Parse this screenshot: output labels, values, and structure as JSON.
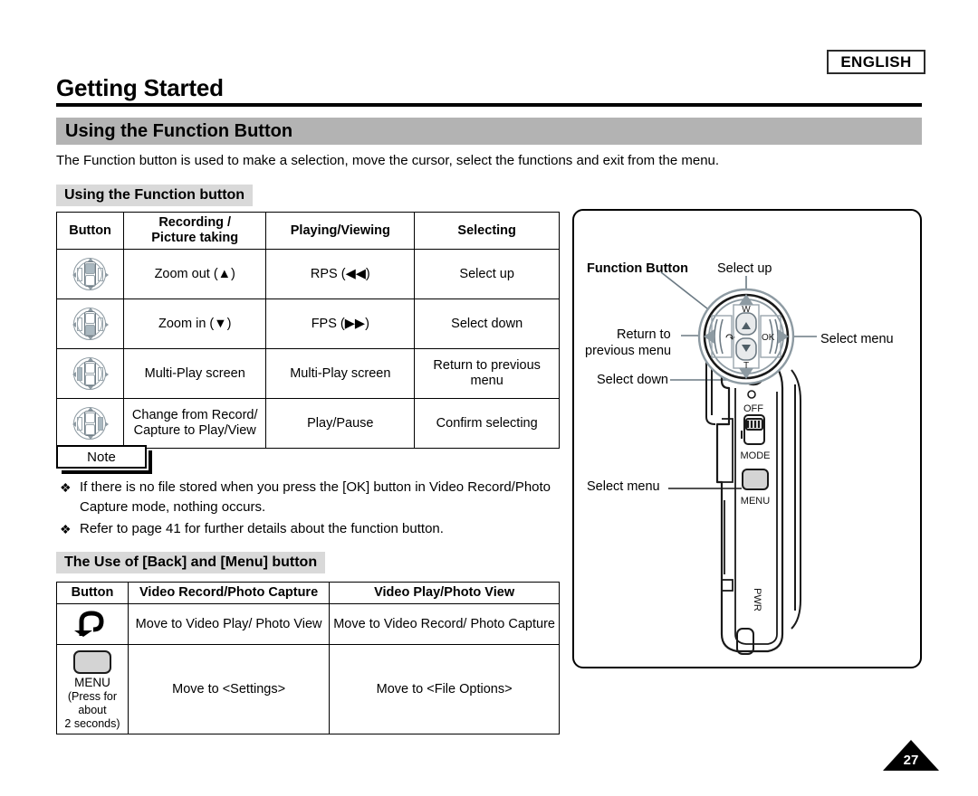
{
  "header": {
    "language_badge": "ENGLISH",
    "chapter_title": "Getting Started",
    "section_title": "Using the Function Button",
    "intro": "The Function button is used to make a selection, move the cursor, select the functions and exit from the menu."
  },
  "subheads": {
    "function_button": "Using the Function button",
    "back_menu": "The Use of [Back] and [Menu] button"
  },
  "function_table": {
    "headers": {
      "button": "Button",
      "recording": "Recording /",
      "recording2": "Picture taking",
      "playing": "Playing/Viewing",
      "selecting": "Selecting"
    },
    "rows": [
      {
        "icon": "dpad-up-icon",
        "recording": "Zoom out (▲)",
        "playing": "RPS (◀◀)",
        "selecting": "Select up"
      },
      {
        "icon": "dpad-down-icon",
        "recording": "Zoom in (▼)",
        "playing": "FPS (▶▶)",
        "selecting": "Select down"
      },
      {
        "icon": "dpad-left-icon",
        "recording": "Multi-Play screen",
        "playing": "Multi-Play screen",
        "selecting": "Return to previous menu"
      },
      {
        "icon": "dpad-right-icon",
        "recording": "Change from Record/ Capture to Play/View",
        "playing": "Play/Pause",
        "selecting": "Confirm selecting"
      }
    ]
  },
  "note": {
    "label": "Note",
    "items": [
      "If there is no file stored when you press the [OK] button in Video Record/Photo Capture mode, nothing occurs.",
      "Refer to page 41 for further details about the function button."
    ],
    "bullet": "❖"
  },
  "backmenu_table": {
    "headers": {
      "button": "Button",
      "record": "Video Record/Photo Capture",
      "play": "Video Play/Photo View"
    },
    "rows": [
      {
        "icon": "back-arrow-icon",
        "record": "Move to Video Play/ Photo View",
        "play": "Move to Video Record/ Photo Capture"
      },
      {
        "icon": "menu-button-icon",
        "icon_label": "MENU",
        "icon_sub1": "(Press for about",
        "icon_sub2": "2 seconds)",
        "record": "Move to <Settings>",
        "play": "Move to <File Options>"
      }
    ]
  },
  "illustration": {
    "title": "Function Button",
    "labels": {
      "select_up": "Select up",
      "select_menu_right": "Select menu",
      "return_prev_1": "Return to",
      "return_prev_2": "previous menu",
      "select_down": "Select down",
      "select_menu_bottom": "Select menu"
    },
    "device": {
      "zoom_wide": "W",
      "zoom_tele": "T",
      "ok": "OK",
      "back": "↶",
      "power_off": "OFF",
      "mode": "MODE",
      "menu": "MENU",
      "pwr_label": "PWR"
    }
  },
  "footer": {
    "page_number": "27"
  },
  "colors": {
    "section_bar": "#b3b3b3",
    "subhead_chip": "#d9d9d9",
    "device_gray": "#d4d4d4",
    "line": "#000000"
  }
}
